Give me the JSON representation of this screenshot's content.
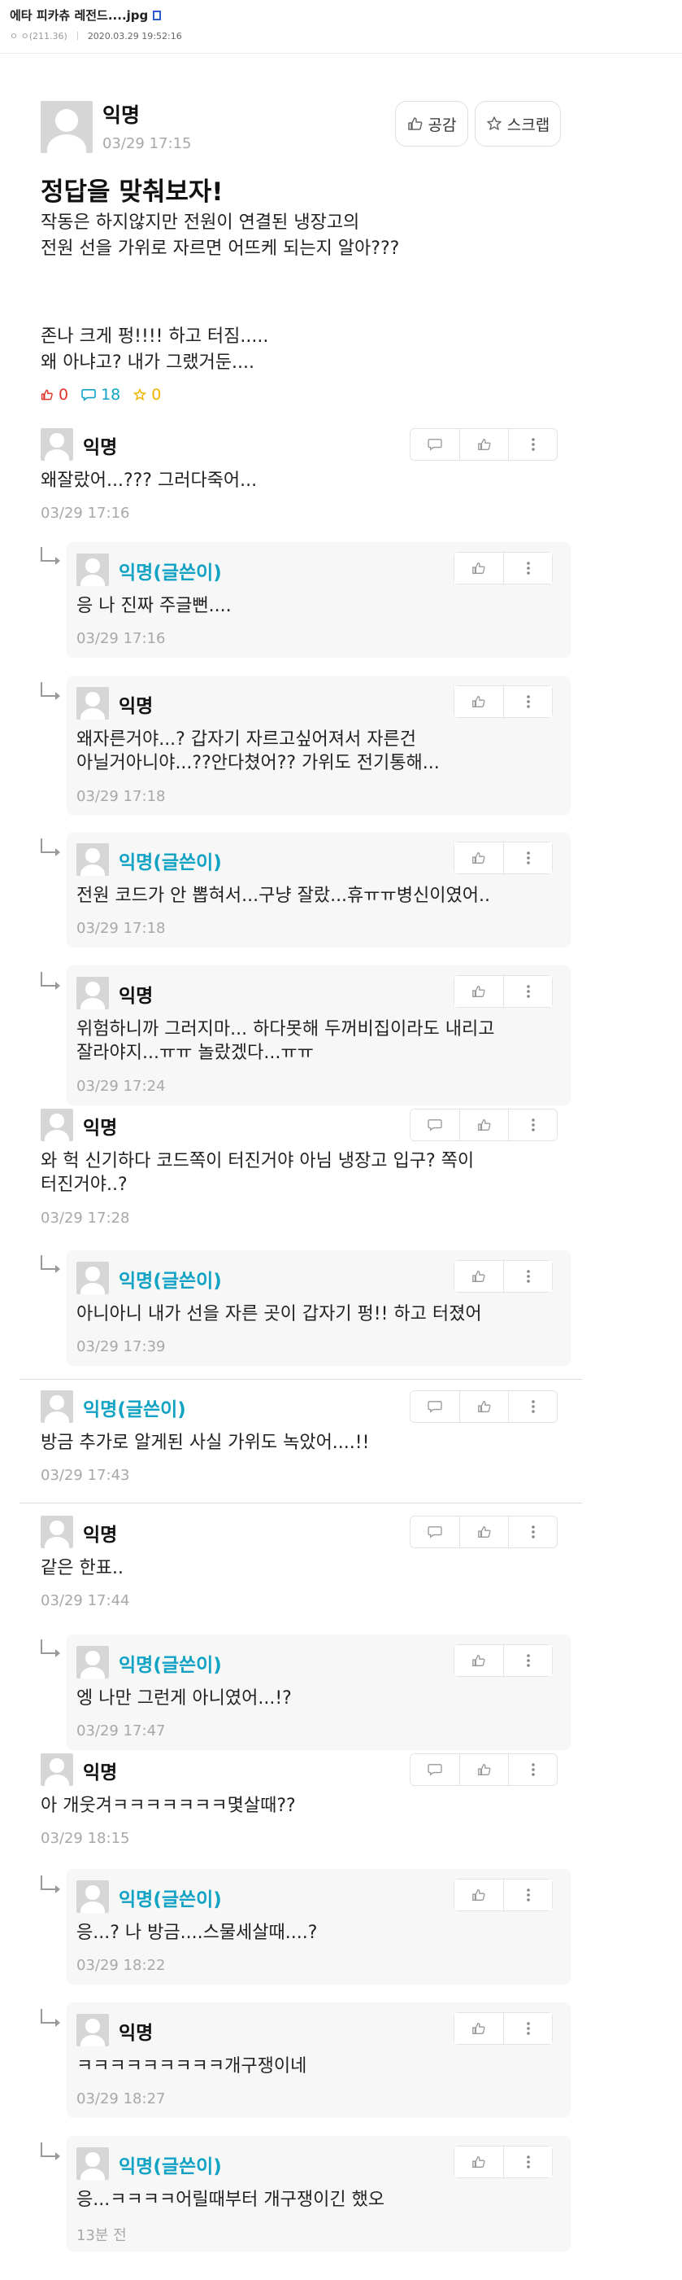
{
  "page": {
    "title": "에타 피카츄 레전드....jpg",
    "meta_ip": "ㅇ ㅇ(211.36)",
    "meta_date": "2020.03.29 19:52:16"
  },
  "post": {
    "author": "익명",
    "time": "03/29 17:15",
    "like_label": "공감",
    "scrap_label": "스크랩",
    "title": "정답을 맞춰보자!",
    "body_1": "작동은 하지않지만 전원이 연결된 냉장고의",
    "body_2": "전원 선을 가위로 자르면 어뜨케 되는지 알아???",
    "body_3": "존나 크게 펑!!!! 하고 터짐.....",
    "body_4": "왜 아냐고? 내가 그랬거둔....",
    "likes": "0",
    "comments": "18",
    "scraps": "0"
  },
  "comments": [
    {
      "author": "익명",
      "body": "왜잘랐어...??? 그러다죽어...",
      "time": "03/29 17:16"
    },
    {
      "author": "익명(글쓴이)",
      "body": "응 나 진짜 주글뻔....",
      "time": "03/29 17:16"
    },
    {
      "author": "익명",
      "body_1": "왜자른거야...? 갑자기 자르고싶어져서 자른건",
      "body_2": "아닐거아니야...??안다쳤어?? 가위도 전기통해...",
      "time": "03/29 17:18"
    },
    {
      "author": "익명(글쓴이)",
      "body": "전원 코드가 안 뽑혀서...구냥 잘랐...휴ㅠㅠ병신이였어..",
      "time": "03/29 17:18"
    },
    {
      "author": "익명",
      "body_1": "위험하니까 그러지마... 하다못해 두꺼비집이라도 내리고",
      "body_2": "잘라야지...ㅠㅠ 놀랐겠다...ㅠㅠ",
      "time": "03/29 17:24"
    },
    {
      "author": "익명",
      "body_1": "와 헉 신기하다 코드쪽이 터진거야 아님 냉장고 입구? 쪽이",
      "body_2": "터진거야..?",
      "time": "03/29 17:28"
    },
    {
      "author": "익명(글쓴이)",
      "body": "아니아니 내가 선을 자른 곳이 갑자기 펑!! 하고 터졌어",
      "time": "03/29 17:39"
    },
    {
      "author": "익명(글쓴이)",
      "body": "방금 추가로 알게된 사실 가위도 녹았어....!!",
      "time": "03/29 17:43"
    },
    {
      "author": "익명",
      "body": "같은 한표..",
      "time": "03/29 17:44"
    },
    {
      "author": "익명(글쓴이)",
      "body": "엥 나만 그런게 아니였어...!?",
      "time": "03/29 17:47"
    },
    {
      "author": "익명",
      "body": "아 개웃겨ㅋㅋㅋㅋㅋㅋㅋ몇살때??",
      "time": "03/29 18:15"
    },
    {
      "author": "익명(글쓴이)",
      "body": "응...? 나 방금....스물세살때....?",
      "time": "03/29 18:22"
    },
    {
      "author": "익명",
      "body": "ㅋㅋㅋㅋㅋㅋㅋㅋㅋ개구쟁이네",
      "time": "03/29 18:27"
    },
    {
      "author": "익명(글쓴이)",
      "body": "응...ㅋㅋㅋㅋ어릴때부터 개구쟁이긴 했오",
      "time": "13분 전"
    }
  ]
}
